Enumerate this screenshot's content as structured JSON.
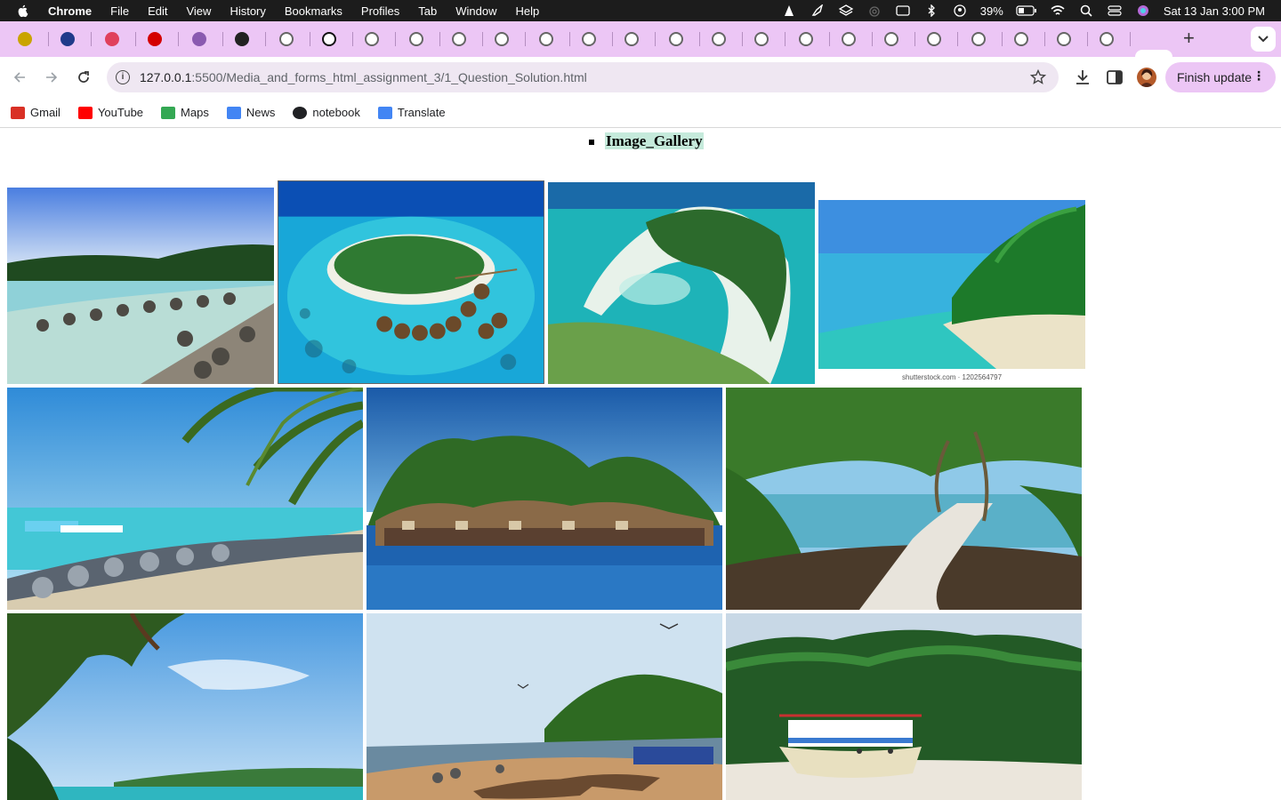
{
  "menubar": {
    "app_name": "Chrome",
    "menus": [
      "File",
      "Edit",
      "View",
      "History",
      "Bookmarks",
      "Profiles",
      "Tab",
      "Window",
      "Help"
    ],
    "battery": "39%",
    "clock": "Sat 13 Jan  3:00 PM"
  },
  "tabs": {
    "favicon_colors": [
      "#c9a400",
      "#1f3a8a",
      "#e0405c",
      "#d40000",
      "#8a5ab0",
      "#222222",
      "#666666",
      "#111111",
      "#666666",
      "#666666",
      "#666666",
      "#666666",
      "#666666",
      "#666666",
      "#666666",
      "#666666",
      "#666666",
      "#666666",
      "#666666",
      "#666666",
      "#666666",
      "#666666",
      "#666666",
      "#666666",
      "#666666",
      "#666666"
    ],
    "active_tab_close": "×",
    "new_tab": "+",
    "tab_list": "⌄"
  },
  "toolbar": {
    "url_host": "127.0.0.1",
    "url_rest": ":5500/Media_and_forms_html_assignment_3/1_Question_Solution.html",
    "finish_update_label": "Finish update"
  },
  "bookmarks": [
    {
      "label": "Gmail",
      "icon": "gmail-icon",
      "color": "#d93025"
    },
    {
      "label": "YouTube",
      "icon": "youtube-icon",
      "color": "#ff0000"
    },
    {
      "label": "Maps",
      "icon": "maps-icon",
      "color": "#34a853"
    },
    {
      "label": "News",
      "icon": "news-icon",
      "color": "#4285f4"
    },
    {
      "label": "notebook",
      "icon": "notebook-icon",
      "color": "#202124"
    },
    {
      "label": "Translate",
      "icon": "translate-icon",
      "color": "#4285f4"
    }
  ],
  "page": {
    "list_item": "Image_Gallery",
    "highlight_color": "#c5eadb",
    "photos": [
      {
        "subject": "island-shore-rocks-photo"
      },
      {
        "subject": "maldives-island-resort-photo"
      },
      {
        "subject": "aerial-island-lagoon-photo"
      },
      {
        "subject": "tropical-beach-palms-photo",
        "caption": "shutterstock.com · 1202564797"
      },
      {
        "subject": "beach-palm-breakwater-photo"
      },
      {
        "subject": "kerala-houseboat-photo"
      },
      {
        "subject": "beach-path-palms-photo"
      },
      {
        "subject": "tropical-coast-sky-photo"
      },
      {
        "subject": "fishing-boats-beach-photo"
      },
      {
        "subject": "stranded-boat-beach-photo"
      }
    ]
  }
}
